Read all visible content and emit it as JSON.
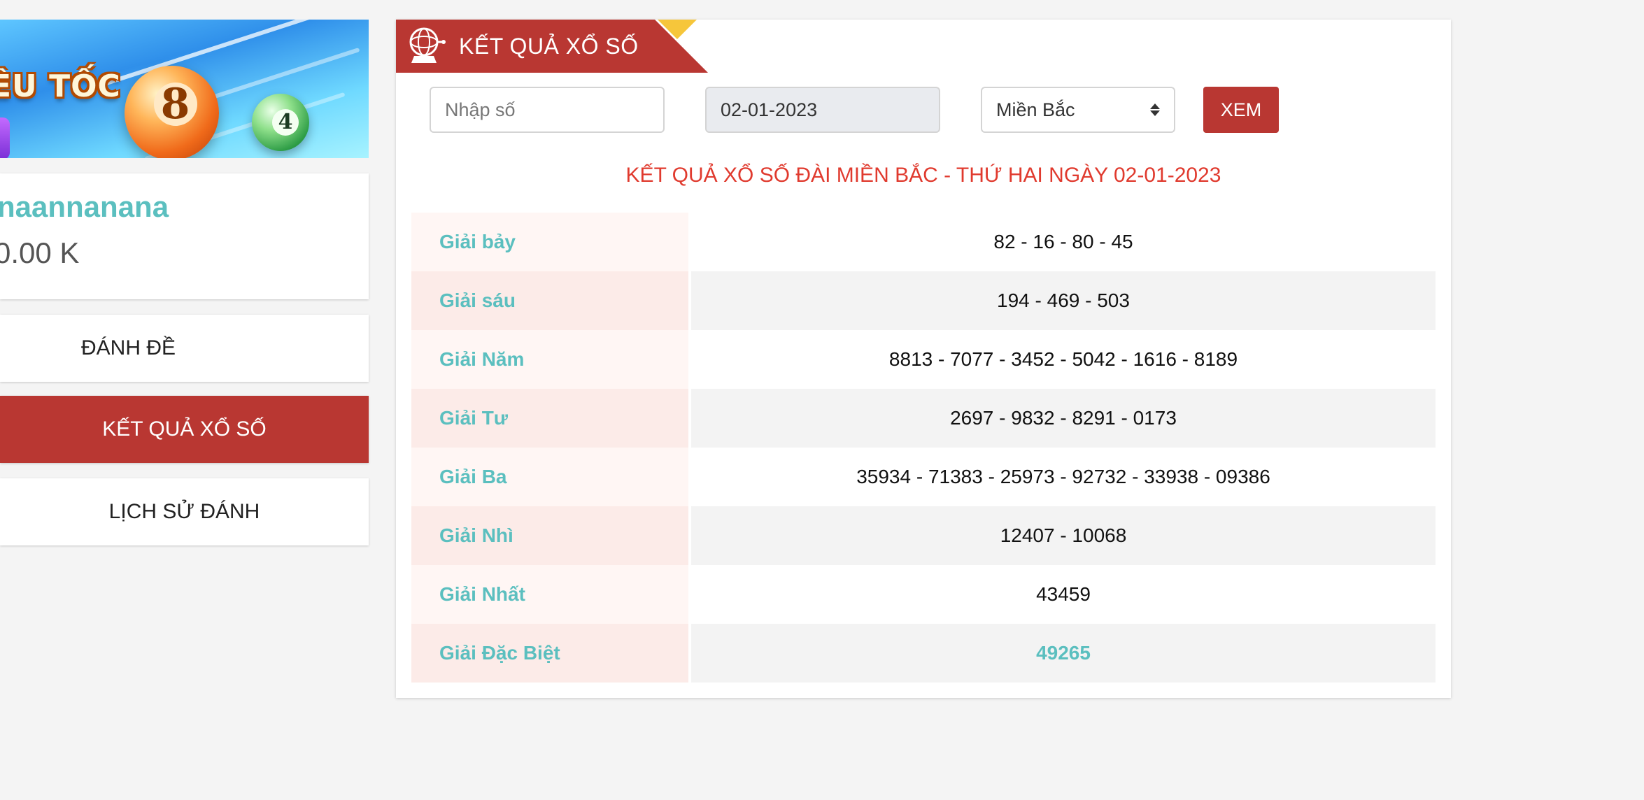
{
  "sidebar": {
    "banner_text": "ÊU TỐC",
    "ball_big": "8",
    "ball_small": "4",
    "username": "naannanana",
    "balance": "0.00 K",
    "nav": [
      {
        "label": "ĐÁNH ĐỀ"
      },
      {
        "label": "KẾT QUẢ XỔ SỐ",
        "active": true
      },
      {
        "label": "LỊCH SỬ ĐÁNH"
      }
    ]
  },
  "main": {
    "ribbon_title": "KẾT QUẢ XỔ SỐ",
    "search_placeholder": "Nhập số",
    "date_value": "02-01-2023",
    "region_value": "Miền Bắc",
    "submit_label": "XEM",
    "heading": "KẾT QUẢ XỔ SỐ ĐÀI MIỀN BẮC - THỨ HAI NGÀY 02-01-2023",
    "results": [
      {
        "prize": "Giải bảy",
        "numbers": "82 - 16 - 80 - 45"
      },
      {
        "prize": "Giải sáu",
        "numbers": "194 - 469 - 503"
      },
      {
        "prize": "Giải Năm",
        "numbers": "8813 - 7077 - 3452 - 5042 - 1616 - 8189"
      },
      {
        "prize": "Giải Tư",
        "numbers": "2697 - 9832 - 8291 - 0173"
      },
      {
        "prize": "Giải Ba",
        "numbers": "35934 - 71383 - 25973 - 92732 - 33938 - 09386"
      },
      {
        "prize": "Giải Nhì",
        "numbers": "12407 - 10068"
      },
      {
        "prize": "Giải Nhất",
        "numbers": "43459"
      },
      {
        "prize": "Giải Đặc Biệt",
        "numbers": "49265"
      }
    ]
  },
  "colors": {
    "brand_red": "#b93732",
    "heading_red": "#e03a2e",
    "teal": "#5bbfbf",
    "ribbon_yellow": "#f6c63b"
  }
}
